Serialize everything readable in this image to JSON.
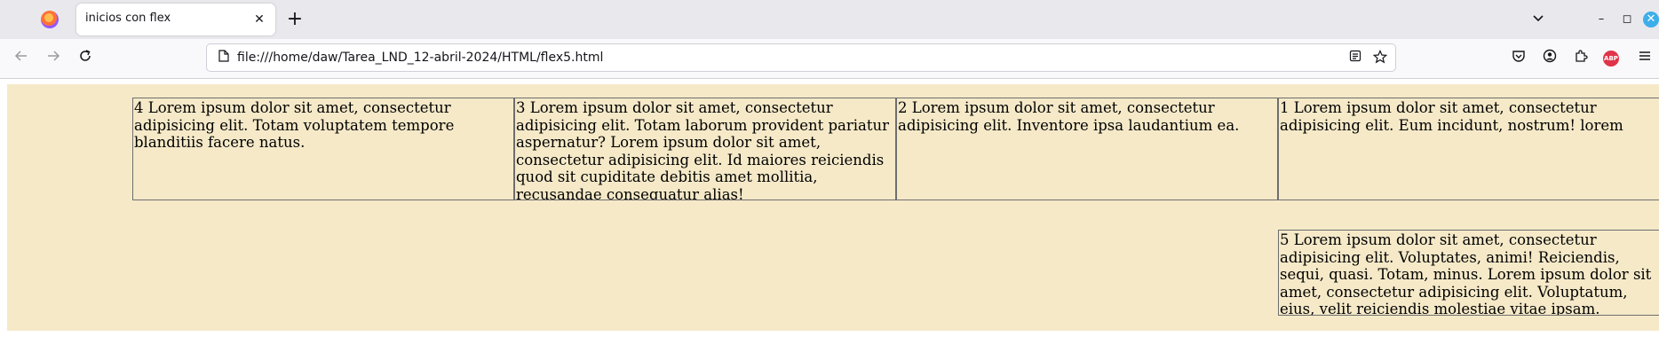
{
  "browser": {
    "tab_title": "inicios con flex",
    "tab_close_glyph": "✕",
    "new_tab_glyph": "+",
    "list_tabs_glyph": "⌄",
    "window_controls": {
      "minimize": "–",
      "maximize": "◻",
      "close": "✕"
    },
    "url": "file:///home/daw/Tarea_LND_12-abril-2024/HTML/flex5.html",
    "icons": {
      "back": "arrow-left-icon",
      "forward": "arrow-right-icon",
      "reload": "reload-icon",
      "page": "page-icon",
      "reader": "reader-view-icon",
      "bookmark": "star-icon",
      "pocket": "pocket-icon",
      "account": "account-icon",
      "extensions": "puzzle-icon",
      "adblock": "adblock-plus-icon",
      "menu": "hamburger-menu-icon"
    },
    "adblock_label": "ABP",
    "accent_colors": {
      "tab_strip": "#e9e9ed",
      "page_background": "#f5e9c8",
      "window_close": "#3daee9",
      "abp": "#e0344a"
    }
  },
  "page": {
    "boxes": [
      {
        "id": "4",
        "text": "4 Lorem ipsum dolor sit amet, consectetur adipisicing elit. Totam voluptatem tempore blanditiis facere natus."
      },
      {
        "id": "3",
        "text": "3 Lorem ipsum dolor sit amet, consectetur adipisicing elit. Totam laborum provident pariatur aspernatur? Lorem ipsum dolor sit amet, consectetur adipisicing elit. Id maiores reiciendis quod sit cupiditate debitis amet mollitia, recusandae consequatur alias!"
      },
      {
        "id": "2",
        "text": "2 Lorem ipsum dolor sit amet, consectetur adipisicing elit. Inventore ipsa laudantium ea."
      },
      {
        "id": "1",
        "text": "1 Lorem ipsum dolor sit amet, consectetur adipisicing elit. Eum incidunt, nostrum! lorem"
      },
      {
        "id": "5",
        "text": "5 Lorem ipsum dolor sit amet, consectetur adipisicing elit. Voluptates, animi! Reiciendis, sequi, quasi. Totam, minus. Lorem ipsum dolor sit amet, consectetur adipisicing elit. Voluptatum, eius, velit reiciendis molestiae vitae ipsam."
      }
    ]
  }
}
